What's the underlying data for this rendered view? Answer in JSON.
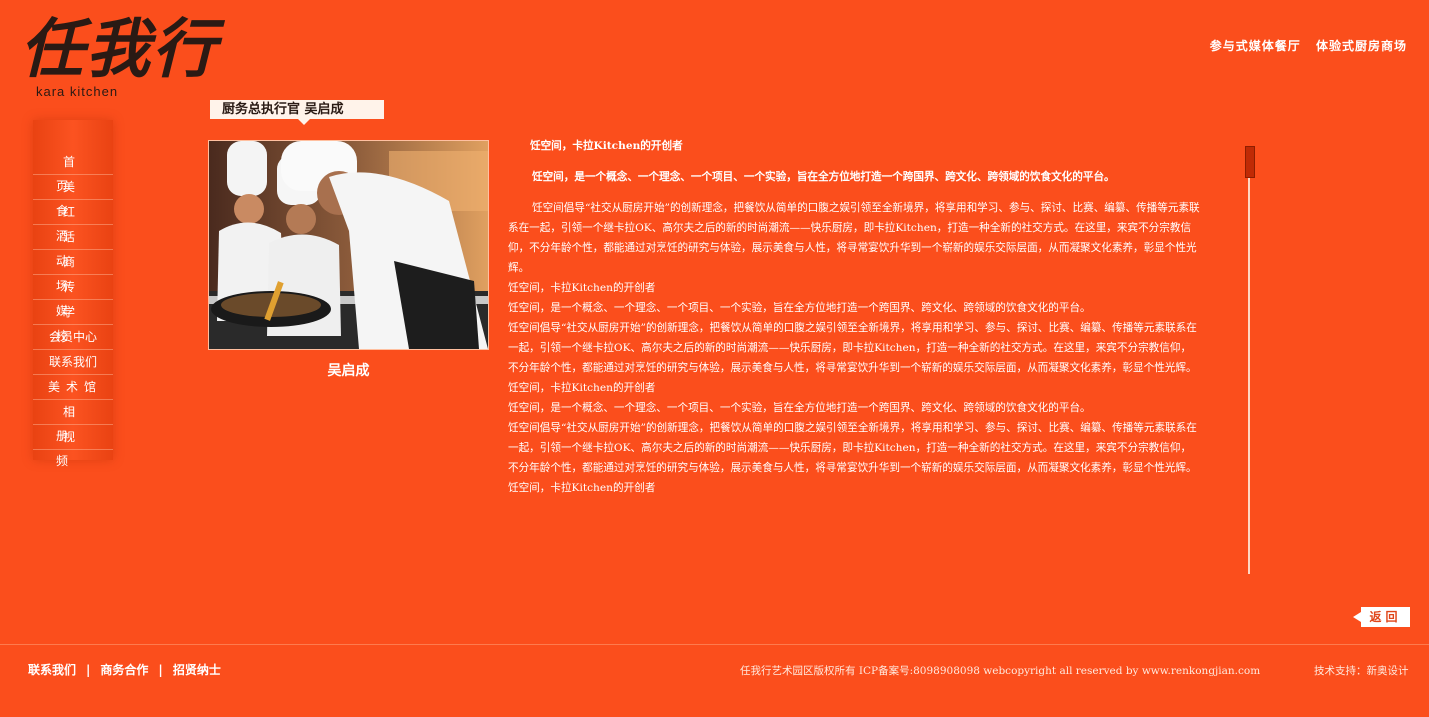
{
  "logo": {
    "cn": "任我行",
    "en": "kara kitchen"
  },
  "tagline": [
    "参与式媒体餐厅",
    "体验式厨房商场"
  ],
  "nav": [
    {
      "label": "首页"
    },
    {
      "label": "美食"
    },
    {
      "label": "红酒"
    },
    {
      "label": "活动"
    },
    {
      "label": "商场"
    },
    {
      "label": "传媒"
    },
    {
      "label": "学校"
    },
    {
      "label": "会员中心"
    },
    {
      "label": "联系我们"
    },
    {
      "label": "美术馆"
    },
    {
      "label": "相册"
    },
    {
      "label": "视频"
    }
  ],
  "page_title": "厨务总执行官  吴启成",
  "photo_caption": "吴启成",
  "article": {
    "heading": "饪空间，卡拉Kitchen的开创者",
    "lead": "饪空间，是一个概念、一个理念、一个项目、一个实验，旨在全方位地打造一个跨国界、跨文化、跨领域的饮食文化的平台。",
    "intro": "饪空间倡导“社交从厨房开始”的创新理念，把餐饮从简单的口腹之娱引领至全新境界，将享用和学习、参与、探讨、比赛、编纂、传播等元素联系在一起，引领一个继卡拉OK、高尔夫之后的新的时尚潮流——快乐厨房，即卡拉Kitchen，打造一种全新的社交方式。在这里，来宾不分宗教信仰，不分年龄个性，都能通过对烹饪的研究与体验，展示美食与人性，将寻常宴饮升华到一个崭新的娱乐交际层面，从而凝聚文化素养，彰显个性光辉。",
    "paragraphs": [
      "饪空间，卡拉Kitchen的开创者",
      "饪空间，是一个概念、一个理念、一个项目、一个实验，旨在全方位地打造一个跨国界、跨文化、跨领域的饮食文化的平台。",
      "饪空间倡导“社交从厨房开始”的创新理念，把餐饮从简单的口腹之娱引领至全新境界，将享用和学习、参与、探讨、比赛、编纂、传播等元素联系在一起，引领一个继卡拉OK、高尔夫之后的新的时尚潮流——快乐厨房，即卡拉Kitchen，打造一种全新的社交方式。在这里，来宾不分宗教信仰，不分年龄个性，都能通过对烹饪的研究与体验，展示美食与人性，将寻常宴饮升华到一个崭新的娱乐交际层面，从而凝聚文化素养，彰显个性光辉。",
      "饪空间，卡拉Kitchen的开创者",
      "饪空间，是一个概念、一个理念、一个项目、一个实验，旨在全方位地打造一个跨国界、跨文化、跨领域的饮食文化的平台。",
      "饪空间倡导“社交从厨房开始”的创新理念，把餐饮从简单的口腹之娱引领至全新境界，将享用和学习、参与、探讨、比赛、编纂、传播等元素联系在一起，引领一个继卡拉OK、高尔夫之后的新的时尚潮流——快乐厨房，即卡拉Kitchen，打造一种全新的社交方式。在这里，来宾不分宗教信仰，不分年龄个性，都能通过对烹饪的研究与体验，展示美食与人性，将寻常宴饮升华到一个崭新的娱乐交际层面，从而凝聚文化素养，彰显个性光辉。",
      "饪空间，卡拉Kitchen的开创者"
    ]
  },
  "back_label": "返回",
  "footer": {
    "links": [
      "联系我们",
      "商务合作",
      "招贤纳士"
    ],
    "separator": "|",
    "copyright": "任我行艺术园区版权所有 ICP备案号:8098908098 webcopyright all reserved by www.renkongjian.com",
    "support": "技术支持：新奥设计"
  },
  "colors": {
    "background": "#fb4e1c",
    "logo": "#2a1a14",
    "tab": "#fff3ea"
  }
}
